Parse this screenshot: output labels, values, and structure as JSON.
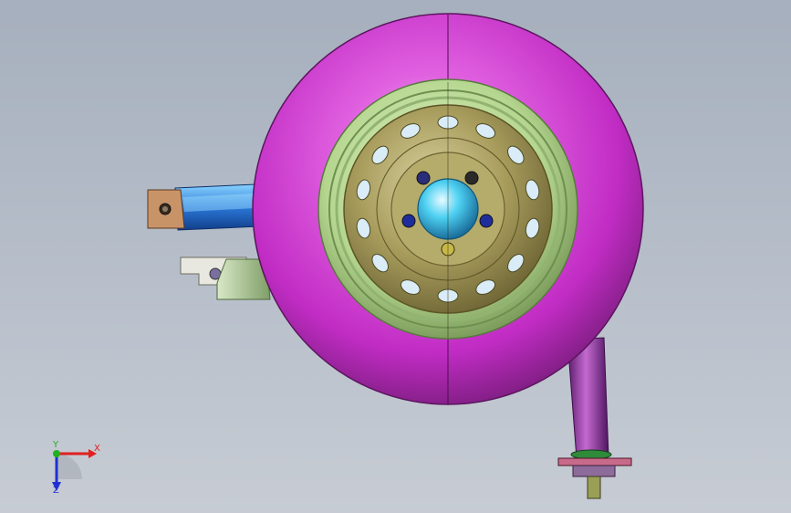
{
  "viewport": {
    "background_top": "#a6afbd",
    "background_bottom": "#c7ccd4"
  },
  "triad": {
    "x_label": "X",
    "y_label": "Y",
    "z_label": "Z",
    "x_color": "#e02020",
    "y_color": "#20b020",
    "z_color": "#2030d0"
  },
  "colors": {
    "tire": "#cc33cc",
    "rim_rings": "#b6d896",
    "wheel_disc": "#a49a5a",
    "hub_cap": "#3fc6ee",
    "control_arm": "#2a78d8",
    "bracket": "#8fb07a",
    "shock_body": "#8a2c9a"
  },
  "icons": {
    "view_triad": "xyz-axis-triad-icon"
  }
}
